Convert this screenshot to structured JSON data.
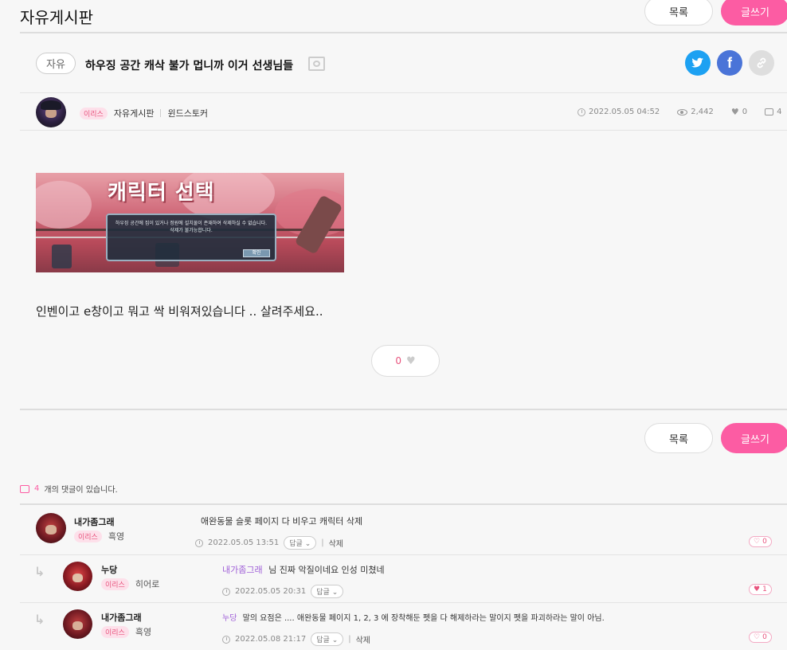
{
  "board_title": "자유게시판",
  "buttons": {
    "list": "목록",
    "write": "글쓰기"
  },
  "post": {
    "category": "자유",
    "title": "하우징 공간 캐삭 불가 멉니까 이거 선생님들",
    "server_badge": "이리스",
    "board": "자유게시판",
    "class": "윈드스토커",
    "date": "2022.05.05 04:52",
    "views": "2,442",
    "likes": "0",
    "comments": "4",
    "image": {
      "headline": "캐릭터 선택",
      "dialog_line1": "하우징 공간에 집이 있거나 정원에 설치물이 존재하여 삭제하실 수 없습니다.",
      "dialog_line2": "삭제가 불가능합니다.",
      "dialog_button": "확인"
    },
    "body": "인벤이고 e창이고 뭐고 싹 비워져있습니다 .. 살려주세요..",
    "like_count": "0"
  },
  "comments_header": {
    "count": "4",
    "suffix": "개의 댓글이 있습니다."
  },
  "comments": [
    {
      "nick": "내가좀그래",
      "server": "이리스",
      "cls": "흑영",
      "mention": "",
      "text": "애완동물 슬롯 페이지 다 비우고 캐릭터 삭제",
      "date": "2022.05.05 13:51",
      "reply": "답글",
      "delete": "삭제",
      "likes": "0"
    },
    {
      "nick": "누당",
      "server": "이리스",
      "cls": "히어로",
      "mention": "내가좀그래",
      "text": "님 진짜 악질이네요 인성 미쳤네",
      "date": "2022.05.05 20:31",
      "reply": "답글",
      "delete": "",
      "likes": "1"
    },
    {
      "nick": "내가좀그래",
      "server": "이리스",
      "cls": "흑영",
      "mention": "누당",
      "text": "말의 요점은 .... 애완동물 페이지 1, 2, 3 에 장착해둔 펫을 다 해제하라는 말이지 펫을 파괴하라는 말이 아님.",
      "date": "2022.05.08 21:17",
      "reply": "답글",
      "delete": "삭제",
      "likes": "0"
    }
  ],
  "colors": {
    "accent": "#fc5ca3",
    "twitter": "#1da1f2",
    "facebook": "#4a74d8",
    "link": "#d8d8d8"
  }
}
